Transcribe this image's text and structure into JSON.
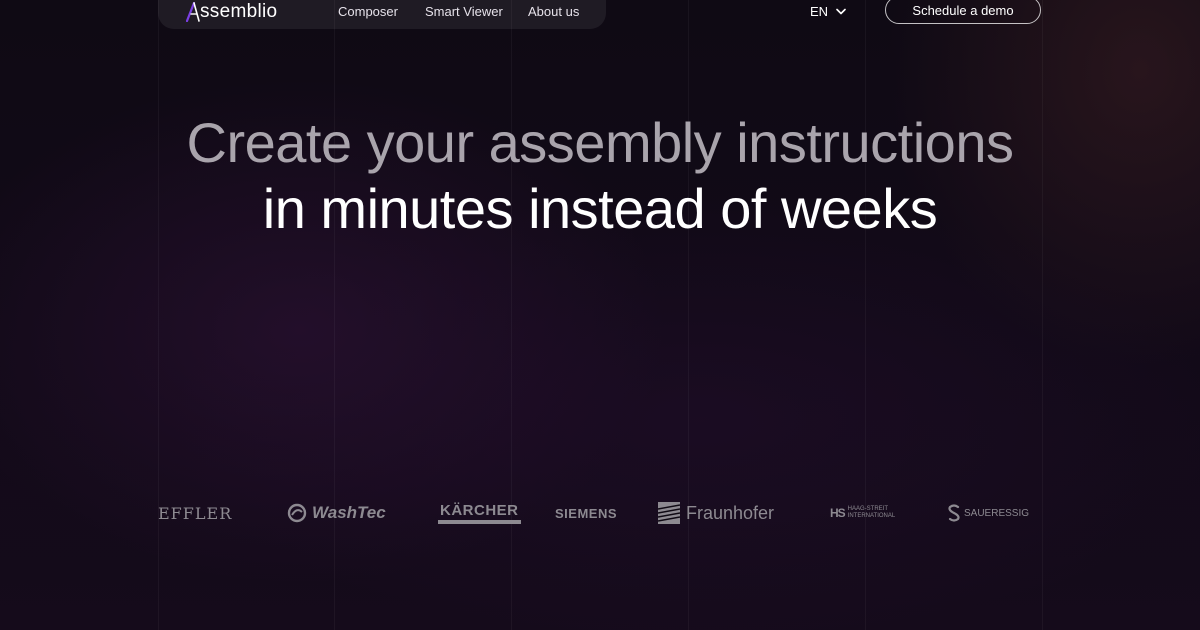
{
  "header": {
    "logo_text": "ssemblio",
    "nav": [
      {
        "label": "Composer"
      },
      {
        "label": "Smart Viewer"
      },
      {
        "label": "About us"
      }
    ],
    "language": "EN",
    "cta_label": "Schedule a demo"
  },
  "hero": {
    "line1": "Create your assembly instructions",
    "line2": "in minutes instead of weeks"
  },
  "clients": [
    {
      "name": "EFFLER"
    },
    {
      "name": "WashTec"
    },
    {
      "name": "KÄRCHER"
    },
    {
      "name": "SIEMENS"
    },
    {
      "name": "Fraunhofer"
    },
    {
      "name": "HAAG-STREIT INTERNATIONAL",
      "line1": "HAAG-STREIT",
      "line2": "INTERNATIONAL"
    },
    {
      "name": "SAUERESSIG"
    }
  ],
  "colors": {
    "background": "#0f0a14",
    "logo_accent": "#7b3fe4",
    "hero_muted": "#a9a4ac",
    "hero_bright": "#ffffff",
    "client_logo": "#8d8a91"
  }
}
